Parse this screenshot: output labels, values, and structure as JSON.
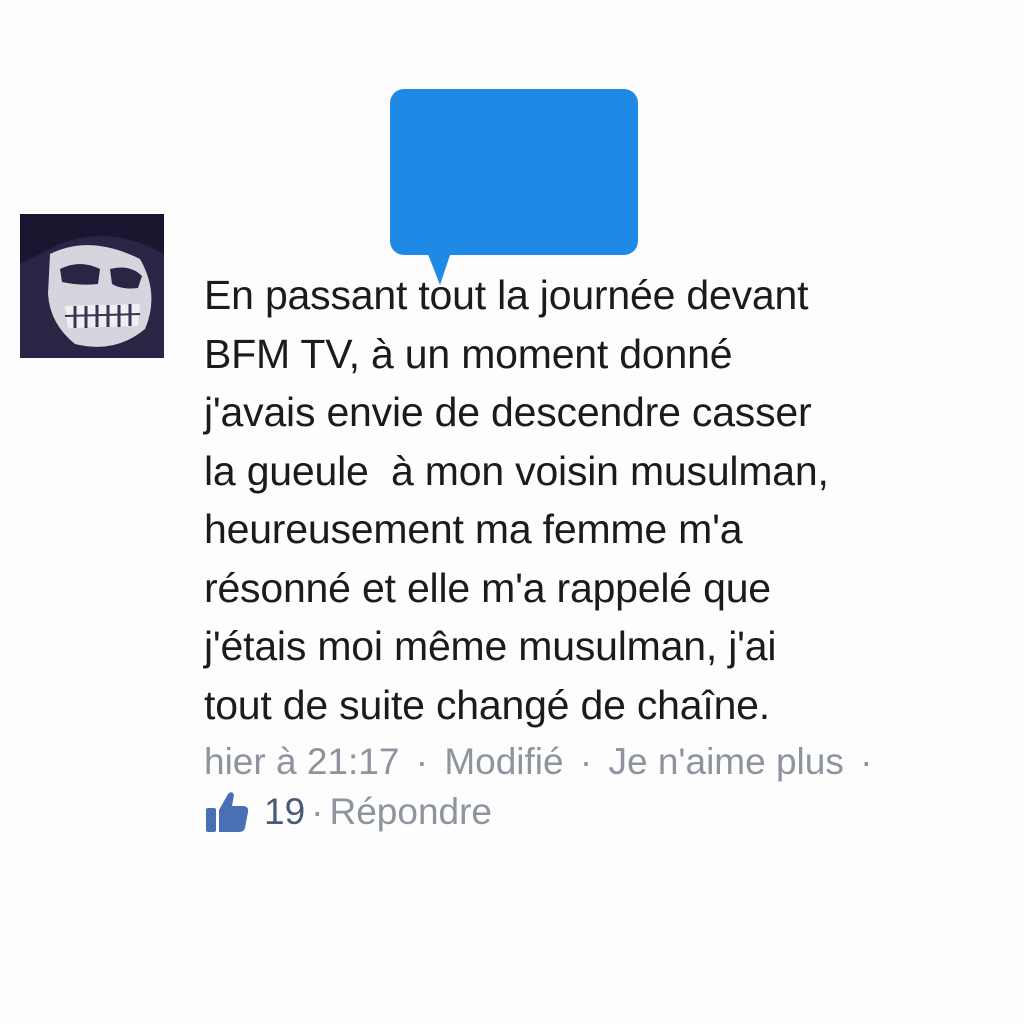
{
  "comment": {
    "lines": [
      "En passant tout la journée devant",
      "BFM TV, à un moment donné",
      "j'avais envie de descendre casser",
      "la gueule  à mon voisin musulman,",
      "heureusement ma femme m'a",
      "résonné et elle m'a rappelé que",
      "j'étais moi même musulman, j'ai",
      "tout de suite changé de chaîne."
    ],
    "timestamp": "hier à 21:17",
    "edited_label": "Modifié",
    "unlike_label": "Je n'aime plus",
    "separator": "·",
    "like_count": "19",
    "reply_label": "Répondre"
  },
  "icons": {
    "avatar": "skull-avatar",
    "redaction": "speech-bubble-redaction",
    "like": "thumbs-up-icon"
  },
  "colors": {
    "text": "#1b1b1b",
    "meta": "#8d949e",
    "redaction_blue": "#1f8ae6",
    "like_blue": "#4a6fb5",
    "background": "#fdfdfd"
  }
}
